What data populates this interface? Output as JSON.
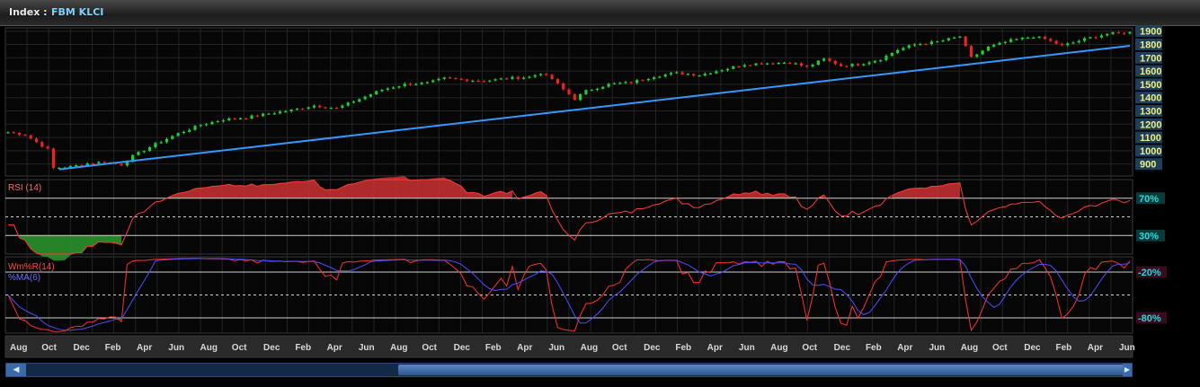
{
  "header": {
    "prefix": "Index :",
    "index_name": "FBM KLCI"
  },
  "colors": {
    "up_candle": "#22cc33",
    "down_candle": "#ee2222",
    "trendline": "#3399ff",
    "rsi_line": "#ff3a3a",
    "rsi_overbought_fill": "#cc3333",
    "rsi_oversold_fill": "#2e9a2e",
    "wmr_line": "#ff3030",
    "ma_line": "#4d4dff",
    "price_label_bg": "#1e3e5a",
    "price_label_text": "#f0f080"
  },
  "chart_data": [
    {
      "type": "candlestick",
      "panel": "price",
      "y_ticks": [
        900,
        1000,
        1100,
        1200,
        1300,
        1400,
        1500,
        1600,
        1700,
        1800,
        1900
      ],
      "ylim": [
        810,
        1925
      ],
      "x_labels": [
        "Aug",
        "Oct",
        "Dec",
        "Feb",
        "Apr",
        "Jun",
        "Aug",
        "Oct",
        "Dec",
        "Feb",
        "Apr",
        "Jun",
        "Aug",
        "Oct",
        "Dec",
        "Feb",
        "Apr",
        "Jun",
        "Aug",
        "Oct",
        "Dec",
        "Feb",
        "Apr",
        "Jun",
        "Aug",
        "Oct",
        "Dec",
        "Feb",
        "Apr",
        "Jun",
        "Aug",
        "Oct",
        "Dec",
        "Feb",
        "Apr",
        "Jun"
      ],
      "anchors": [
        [
          0,
          1140
        ],
        [
          3,
          1120
        ],
        [
          7,
          1010
        ],
        [
          8,
          870
        ],
        [
          11,
          880
        ],
        [
          14,
          905
        ],
        [
          17,
          915
        ],
        [
          20,
          895
        ],
        [
          22,
          960
        ],
        [
          26,
          1050
        ],
        [
          30,
          1130
        ],
        [
          34,
          1195
        ],
        [
          38,
          1235
        ],
        [
          42,
          1250
        ],
        [
          46,
          1280
        ],
        [
          50,
          1305
        ],
        [
          54,
          1340
        ],
        [
          58,
          1320
        ],
        [
          62,
          1390
        ],
        [
          66,
          1460
        ],
        [
          70,
          1500
        ],
        [
          74,
          1510
        ],
        [
          77,
          1545
        ],
        [
          80,
          1535
        ],
        [
          84,
          1525
        ],
        [
          88,
          1545
        ],
        [
          92,
          1555
        ],
        [
          94,
          1585
        ],
        [
          96,
          1540
        ],
        [
          98,
          1460
        ],
        [
          100,
          1390
        ],
        [
          102,
          1450
        ],
        [
          106,
          1500
        ],
        [
          110,
          1515
        ],
        [
          114,
          1560
        ],
        [
          118,
          1585
        ],
        [
          122,
          1570
        ],
        [
          126,
          1610
        ],
        [
          130,
          1650
        ],
        [
          134,
          1660
        ],
        [
          138,
          1665
        ],
        [
          141,
          1630
        ],
        [
          144,
          1690
        ],
        [
          147,
          1640
        ],
        [
          150,
          1650
        ],
        [
          154,
          1690
        ],
        [
          157,
          1760
        ],
        [
          160,
          1800
        ],
        [
          164,
          1820
        ],
        [
          166,
          1840
        ],
        [
          168,
          1860
        ],
        [
          170,
          1700
        ],
        [
          173,
          1780
        ],
        [
          177,
          1830
        ],
        [
          181,
          1860
        ],
        [
          183,
          1840
        ],
        [
          186,
          1790
        ],
        [
          190,
          1840
        ],
        [
          194,
          1880
        ],
        [
          198,
          1890
        ]
      ],
      "trendline": {
        "start": [
          9,
          860
        ],
        "end": [
          198,
          1790
        ]
      }
    },
    {
      "type": "line",
      "panel": "rsi",
      "title": "RSI (14)",
      "y_ticks_labels": [
        "70%",
        "30%"
      ],
      "levels": [
        70,
        50,
        30
      ],
      "ylim": [
        10,
        90
      ]
    },
    {
      "type": "line",
      "panel": "williams",
      "series": [
        {
          "name": "Wm%R(14)"
        },
        {
          "name": "%MA(6)"
        }
      ],
      "y_ticks_labels": [
        "-20%",
        "-80%"
      ],
      "levels": [
        -20,
        -50,
        -80
      ],
      "ylim": [
        -100,
        0
      ]
    }
  ]
}
